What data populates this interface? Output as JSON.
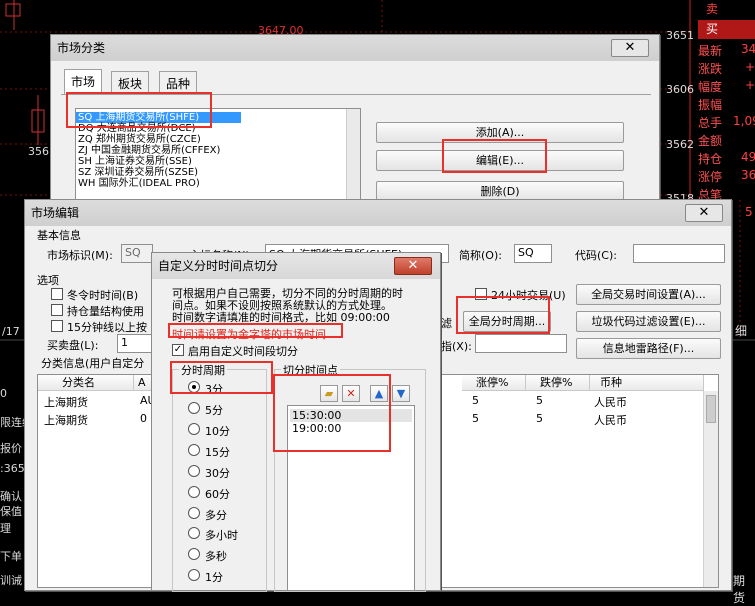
{
  "background": {
    "price_labels": [
      "3647.00",
      "3651",
      "3606",
      "3562",
      "3518",
      "356",
      "/17"
    ],
    "buy_label": "卖",
    "sell_label": "买",
    "quote_labels": [
      "最新",
      "涨跌",
      "幅度",
      "振幅",
      "总手",
      "金额",
      "持仓",
      "涨停",
      "总笔"
    ],
    "quote_values": [
      "34",
      "+",
      "+",
      "",
      "1,09",
      "",
      "49",
      "36",
      ""
    ],
    "right_misc": [
      "5",
      "细",
      "期货"
    ],
    "left_fragments": [
      "0",
      "限连续",
      "报价",
      ":365",
      "确认",
      "保值",
      "理",
      "下单",
      "训诫"
    ]
  },
  "market_window": {
    "title": "市场分类",
    "close": "✕",
    "tabs": [
      "市场",
      "板块",
      "品种"
    ],
    "exchanges": [
      "SQ 上海期货交易所(SHFE)",
      "DQ 大连商品交易所(DCE)",
      "ZQ 郑州期货交易所(CZCE)",
      "ZJ 中国金融期货交易所(CFFEX)",
      "SH 上海证券交易所(SSE)",
      "SZ 深圳证券交易所(SZSE)",
      "WH 国际外汇(IDEAL PRO)"
    ],
    "buttons": {
      "add": "添加(A)...",
      "edit": "编辑(E)...",
      "delete": "删除(D)"
    }
  },
  "edit_window": {
    "title": "市场编辑",
    "close": "✕",
    "basic_info": "基本信息",
    "market_id_label": "市场标识(M):",
    "market_id_value": "SQ",
    "main_name_label": "主标名称(N):",
    "main_name_value": "SQ 上海期货交易所(SHFE)",
    "short_name_label": "简称(O):",
    "short_name_value": "SQ",
    "code_label": "代码(C):",
    "code_value": "",
    "options_label": "选项",
    "opt_winter": "冬令时时间(B)",
    "opt_position": "持仓量结构使用",
    "opt_15min": "15分钟线以上按",
    "opt_24h": "24小时交易(U)",
    "opt_fragment": "滤",
    "buy_sell_label": "买卖盘(L):",
    "buy_sell_value": "1",
    "index_label": "指(X):",
    "btn_global_time": "全局交易时间设置(A)...",
    "btn_global_period": "全局分时周期...",
    "btn_junk_filter": "垃圾代码过滤设置(E)...",
    "btn_info_path": "信息地雷路径(F)...",
    "category_info": "分类信息(用户自定分",
    "table": {
      "headers": [
        "分类名",
        "A",
        "涨停%",
        "跌停%",
        "币种"
      ],
      "rows": [
        [
          "上海期货",
          "AU",
          "5",
          "5",
          "人民币"
        ],
        [
          "上海期货",
          "0",
          "5",
          "5",
          "人民币"
        ]
      ]
    }
  },
  "period_dialog": {
    "title": "自定义分时时间点切分",
    "close": "✕",
    "desc_line1": "可根据用户自己需要，切分不同的分时周期的时",
    "desc_line2": "间点。如果不设则按照系统默认的方式处理。",
    "desc_line3": "时间数字请填准的时间格式，比如 09:00:00",
    "warning": "时间请设置为金字塔的市场时间",
    "enable_label": "启用自定义时间段切分",
    "period_group": "分时周期",
    "periods": [
      "3分",
      "5分",
      "10分",
      "15分",
      "30分",
      "60分",
      "多分",
      "多小时",
      "多秒",
      "1分"
    ],
    "selected_period": "3分",
    "points_group": "切分时间点",
    "time_points": [
      "15:30:00",
      "19:00:00"
    ]
  }
}
